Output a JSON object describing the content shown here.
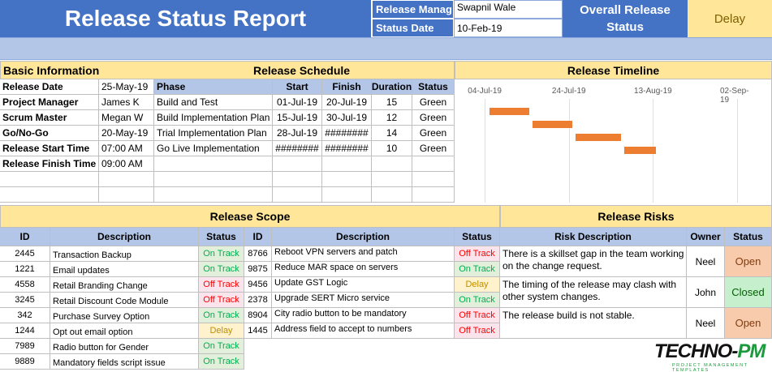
{
  "header": {
    "title": "Release Status Report",
    "release_manager_label": "Release Manag",
    "release_manager_value": "Swapnil Wale",
    "status_date_label": "Status Date",
    "status_date_value": "10-Feb-19",
    "overall_label_1": "Overall Release",
    "overall_label_2": "Status",
    "overall_value": "Delay"
  },
  "basic_info": {
    "title": "Basic Information",
    "rows": [
      {
        "label": "Release Date",
        "value": "25-May-19"
      },
      {
        "label": "Project Manager",
        "value": "James K"
      },
      {
        "label": "Scrum Master",
        "value": "Megan W"
      },
      {
        "label": "Go/No-Go",
        "value": "20-May-19"
      },
      {
        "label": "Release Start Time",
        "value": "07:00 AM"
      },
      {
        "label": "Release Finish Time",
        "value": "09:00 AM"
      }
    ]
  },
  "schedule": {
    "title": "Release Schedule",
    "columns": [
      "Phase",
      "Start",
      "Finish",
      "Duration",
      "Status"
    ],
    "rows": [
      {
        "phase": "Build and Test",
        "start": "01-Jul-19",
        "finish": "20-Jul-19",
        "duration": "15",
        "status": "Green"
      },
      {
        "phase": "Build Implementation Plan",
        "start": "15-Jul-19",
        "finish": "30-Jul-19",
        "duration": "12",
        "status": "Green"
      },
      {
        "phase": "Trial Implementation Plan",
        "start": "28-Jul-19",
        "finish": "########",
        "duration": "14",
        "status": "Green"
      },
      {
        "phase": "Go Live Implementation",
        "start": "########",
        "finish": "########",
        "duration": "10",
        "status": "Green"
      }
    ]
  },
  "timeline": {
    "title": "Release Timeline",
    "dates": [
      "04-Jul-19",
      "24-Jul-19",
      "13-Aug-19",
      "02-Sep-19"
    ],
    "bars": [
      {
        "start": 0.11,
        "end": 0.235
      },
      {
        "start": 0.245,
        "end": 0.37
      },
      {
        "start": 0.38,
        "end": 0.525
      },
      {
        "start": 0.535,
        "end": 0.635
      }
    ]
  },
  "scope": {
    "title": "Release Scope",
    "columns": [
      "ID",
      "Description",
      "Status"
    ],
    "left": [
      {
        "id": "2445",
        "desc": "Transaction Backup",
        "status": "On Track"
      },
      {
        "id": "1221",
        "desc": "Email updates",
        "status": "On Track"
      },
      {
        "id": "4558",
        "desc": "Retail Branding Change",
        "status": "Off Track"
      },
      {
        "id": "3245",
        "desc": "Retail Discount Code Module",
        "status": "Off Track"
      },
      {
        "id": "342",
        "desc": "Purchase Survey Option",
        "status": "On Track"
      },
      {
        "id": "1244",
        "desc": "Opt out email option",
        "status": "Delay"
      },
      {
        "id": "7989",
        "desc": "Radio button for Gender",
        "status": "On Track"
      },
      {
        "id": "9889",
        "desc": "Mandatory fields script issue",
        "status": "On Track"
      }
    ],
    "right": [
      {
        "id": "8766",
        "desc": "Reboot VPN servers and patch",
        "status": "Off Track"
      },
      {
        "id": "9875",
        "desc": "Reduce MAR space on servers",
        "status": "On Track"
      },
      {
        "id": "9456",
        "desc": "Update GST Logic",
        "status": "Delay"
      },
      {
        "id": "2378",
        "desc": "Upgrade SERT Micro service",
        "status": "On Track"
      },
      {
        "id": "8904",
        "desc": "City radio button to be mandatory",
        "status": "Off Track"
      },
      {
        "id": "1445",
        "desc": "Address field to accept to numbers",
        "status": "Off Track"
      }
    ]
  },
  "risks": {
    "title": "Release Risks",
    "columns": [
      "Risk Description",
      "Owner",
      "Status"
    ],
    "rows": [
      {
        "desc": "There is a skillset gap in the team working on the change request.",
        "owner": "Neel",
        "status": "Open"
      },
      {
        "desc": "The timing of the release may clash with other system changes.",
        "owner": "John",
        "status": "Closed"
      },
      {
        "desc": "The release build is not stable.",
        "owner": "Neel",
        "status": "Open"
      }
    ]
  },
  "logo": {
    "main": "TECHNO-PM",
    "main_a": "TECHNO-",
    "main_b": "PM",
    "sub": "PROJECT MANAGEMENT TEMPLATES"
  },
  "colors": {
    "header_blue": "#4472c4",
    "section_yellow": "#ffe699",
    "table_header": "#b4c6e7",
    "bar_orange": "#ed7d31"
  }
}
